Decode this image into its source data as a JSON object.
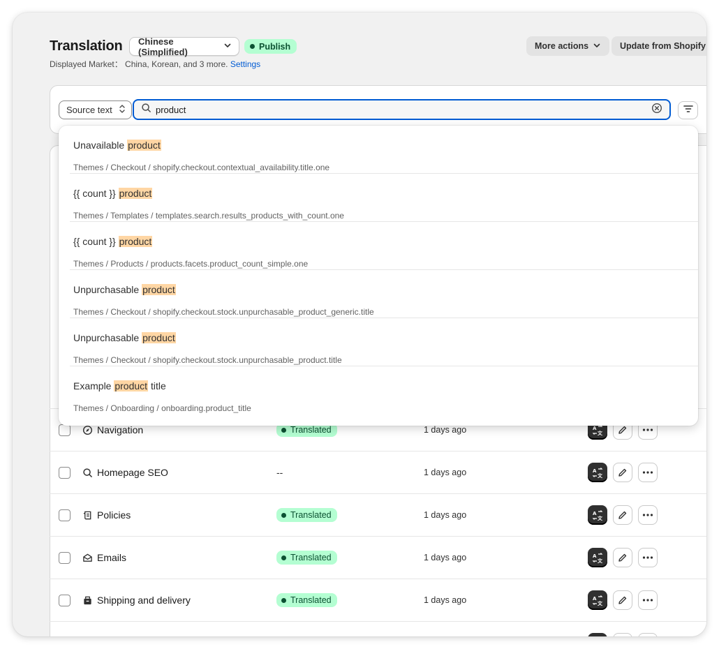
{
  "header": {
    "title": "Translation",
    "language": "Chinese (Simplified)",
    "publish_label": "Publish",
    "market_prefix": "Displayed Market：",
    "market_value": "China, Korean, and 3 more.",
    "settings_link": "Settings",
    "more_actions": "More actions",
    "update_label": "Update from Shopify"
  },
  "search": {
    "source_label": "Source text",
    "query": "product"
  },
  "suggestions": [
    {
      "before": "Unavailable ",
      "match": "product",
      "after": "",
      "path": "Themes  /  Checkout / shopify.checkout.contextual_availability.title.one"
    },
    {
      "before": "{{ count }} ",
      "match": "product",
      "after": "",
      "path": "Themes  /  Templates / templates.search.results_products_with_count.one"
    },
    {
      "before": "{{ count }} ",
      "match": "product",
      "after": "",
      "path": "Themes  /  Products / products.facets.product_count_simple.one"
    },
    {
      "before": "Unpurchasable ",
      "match": "product",
      "after": "",
      "path": "Themes  /  Checkout / shopify.checkout.stock.unpurchasable_product_generic.title"
    },
    {
      "before": "Unpurchasable ",
      "match": "product",
      "after": "",
      "path": "Themes  /  Checkout / shopify.checkout.stock.unpurchasable_product.title"
    },
    {
      "before": "Example ",
      "match": "product",
      "after": " title",
      "path": "Themes  /  Onboarding / onboarding.product_title"
    }
  ],
  "rows": [
    {
      "name": "Navigation",
      "icon": "compass-icon",
      "status": "Translated",
      "updated": "1 days ago"
    },
    {
      "name": "Homepage SEO",
      "icon": "search-icon",
      "status": "--",
      "updated": "1 days ago"
    },
    {
      "name": "Policies",
      "icon": "policy-icon",
      "status": "Translated",
      "updated": "1 days ago"
    },
    {
      "name": "Emails",
      "icon": "email-icon",
      "status": "Translated",
      "updated": "1 days ago"
    },
    {
      "name": "Shipping and delivery",
      "icon": "delivery-icon",
      "status": "Translated",
      "updated": "1 days ago"
    }
  ],
  "colors": {
    "accent": "#005bd3",
    "success_bg": "#b4fed2",
    "success_text": "#0c5132",
    "highlight": "#ffd6a4"
  }
}
